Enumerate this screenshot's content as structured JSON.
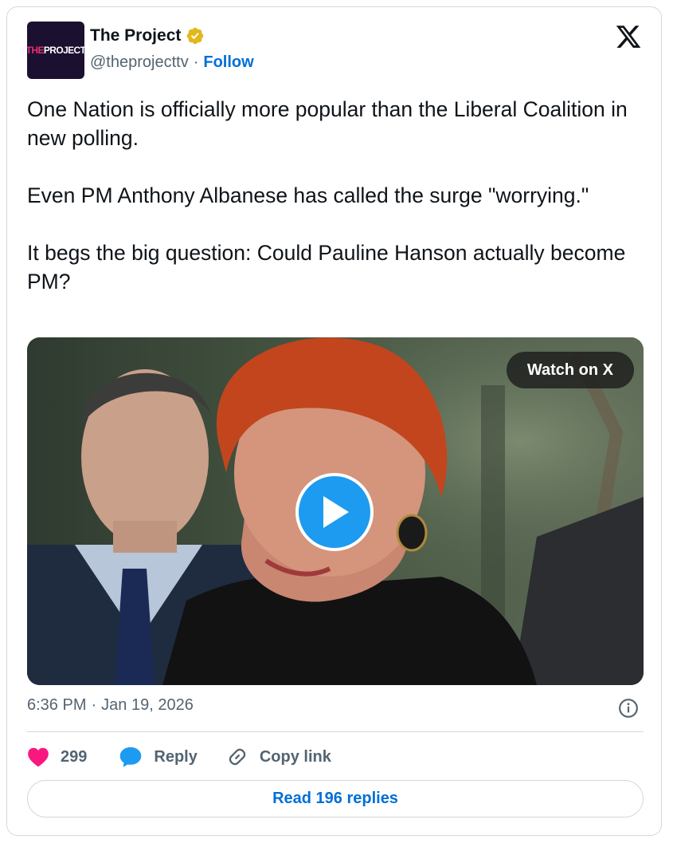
{
  "author": {
    "display_name": "The Project",
    "handle": "@theprojecttv",
    "separator": "·",
    "follow_label": "Follow",
    "avatar_text_the": "THE",
    "avatar_text_project": "PROJECT",
    "verified_color": "#e2b719"
  },
  "icons": {
    "platform": "x-logo-icon",
    "verified": "verified-badge-icon",
    "play": "play-icon",
    "info": "info-icon",
    "like": "heart-icon",
    "reply": "speech-bubble-icon",
    "copy": "link-icon"
  },
  "tweet": {
    "paragraphs": [
      "One Nation is officially more popular than the Liberal Coalition in new polling.",
      "Even PM Anthony Albanese has called the surge \"worrying.\"",
      "It begs the big question: Could Pauline Hanson actually become PM?"
    ]
  },
  "media": {
    "watch_label": "Watch on X"
  },
  "meta": {
    "time": "6:36 PM",
    "separator": "·",
    "date": "Jan 19, 2026"
  },
  "actions": {
    "likes_count": "299",
    "reply_label": "Reply",
    "copy_label": "Copy link"
  },
  "footer": {
    "read_replies_label": "Read 196 replies"
  },
  "colors": {
    "accent": "#006fd6",
    "play": "#1d9bf0",
    "like": "#f91880",
    "text_secondary": "#536471",
    "border": "#cfd9de"
  }
}
